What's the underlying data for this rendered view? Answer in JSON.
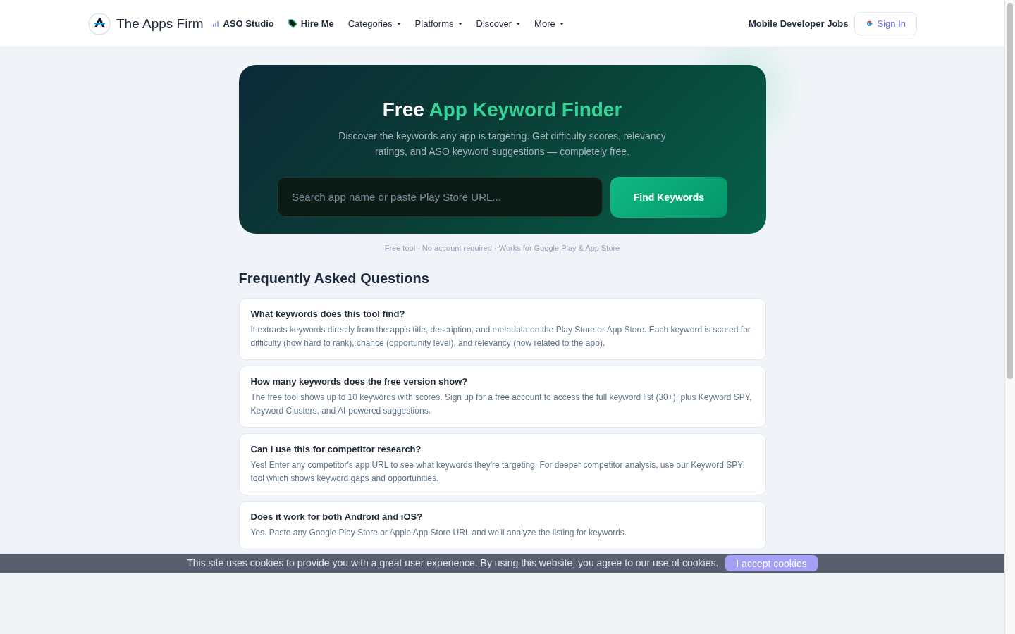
{
  "header": {
    "brand": "The Apps Firm",
    "nav": [
      {
        "label": "ASO Studio",
        "kind": "chart"
      },
      {
        "label": "Hire Me",
        "kind": "tag"
      },
      {
        "label": "Categories",
        "kind": "dropdown"
      },
      {
        "label": "Platforms",
        "kind": "dropdown"
      },
      {
        "label": "Discover",
        "kind": "dropdown"
      },
      {
        "label": "More",
        "kind": "dropdown"
      }
    ],
    "jobs_link": "Mobile Developer Jobs",
    "sign_in": "Sign In"
  },
  "hero": {
    "title_plain": "Free",
    "title_accent": "App Keyword Finder",
    "subtitle": "Discover the keywords any app is targeting. Get difficulty scores, relevancy ratings, and ASO keyword suggestions — completely free.",
    "search": {
      "placeholder": "Search app name or paste Play Store URL..."
    },
    "button": "Find Keywords"
  },
  "note": "Free tool · No account required · Works for Google Play & App Store",
  "faq": {
    "heading": "Frequently Asked Questions",
    "items": [
      {
        "question": "What keywords does this tool find?",
        "answer": "It extracts keywords directly from the app's title, description, and metadata on the Play Store or App Store. Each keyword is scored for difficulty (how hard to rank), chance (opportunity level), and relevancy (how related to the app)."
      },
      {
        "question": "How many keywords does the free version show?",
        "answer": "The free tool shows up to 10 keywords with scores. Sign up for a free account to access the full keyword list (30+), plus Keyword SPY, Keyword Clusters, and AI-powered suggestions."
      },
      {
        "question": "Can I use this for competitor research?",
        "answer": "Yes! Enter any competitor's app URL to see what keywords they're targeting. For deeper competitor analysis, use our Keyword SPY tool which shows keyword gaps and opportunities."
      },
      {
        "question": "Does it work for both Android and iOS?",
        "answer": "Yes. Paste any Google Play Store or Apple App Store URL and we'll analyze the listing for keywords."
      }
    ]
  },
  "cookie_banner": {
    "message": "This site uses cookies to provide you with a great user experience. By using this website, you agree to our use of cookies.",
    "button": "I accept cookies"
  }
}
